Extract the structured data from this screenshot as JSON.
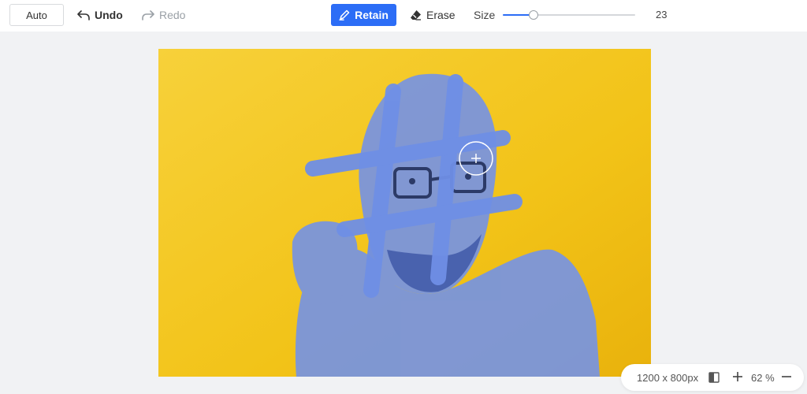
{
  "toolbar": {
    "auto_label": "Auto",
    "undo_label": "Undo",
    "redo_label": "Redo",
    "retain_label": "Retain",
    "erase_label": "Erase",
    "size_label": "Size",
    "size_value": "23",
    "size_fraction": 0.23,
    "icons": {
      "undo": "undo-arrow-icon",
      "redo": "redo-arrow-icon",
      "retain": "brush-icon",
      "erase": "eraser-icon"
    }
  },
  "colors": {
    "accent": "#2c6df6",
    "background_yellow": "#f2c318",
    "mask_overlay": "#6f8fe6"
  },
  "status": {
    "dimensions": "1200 x 800px",
    "zoom": "62 %"
  }
}
